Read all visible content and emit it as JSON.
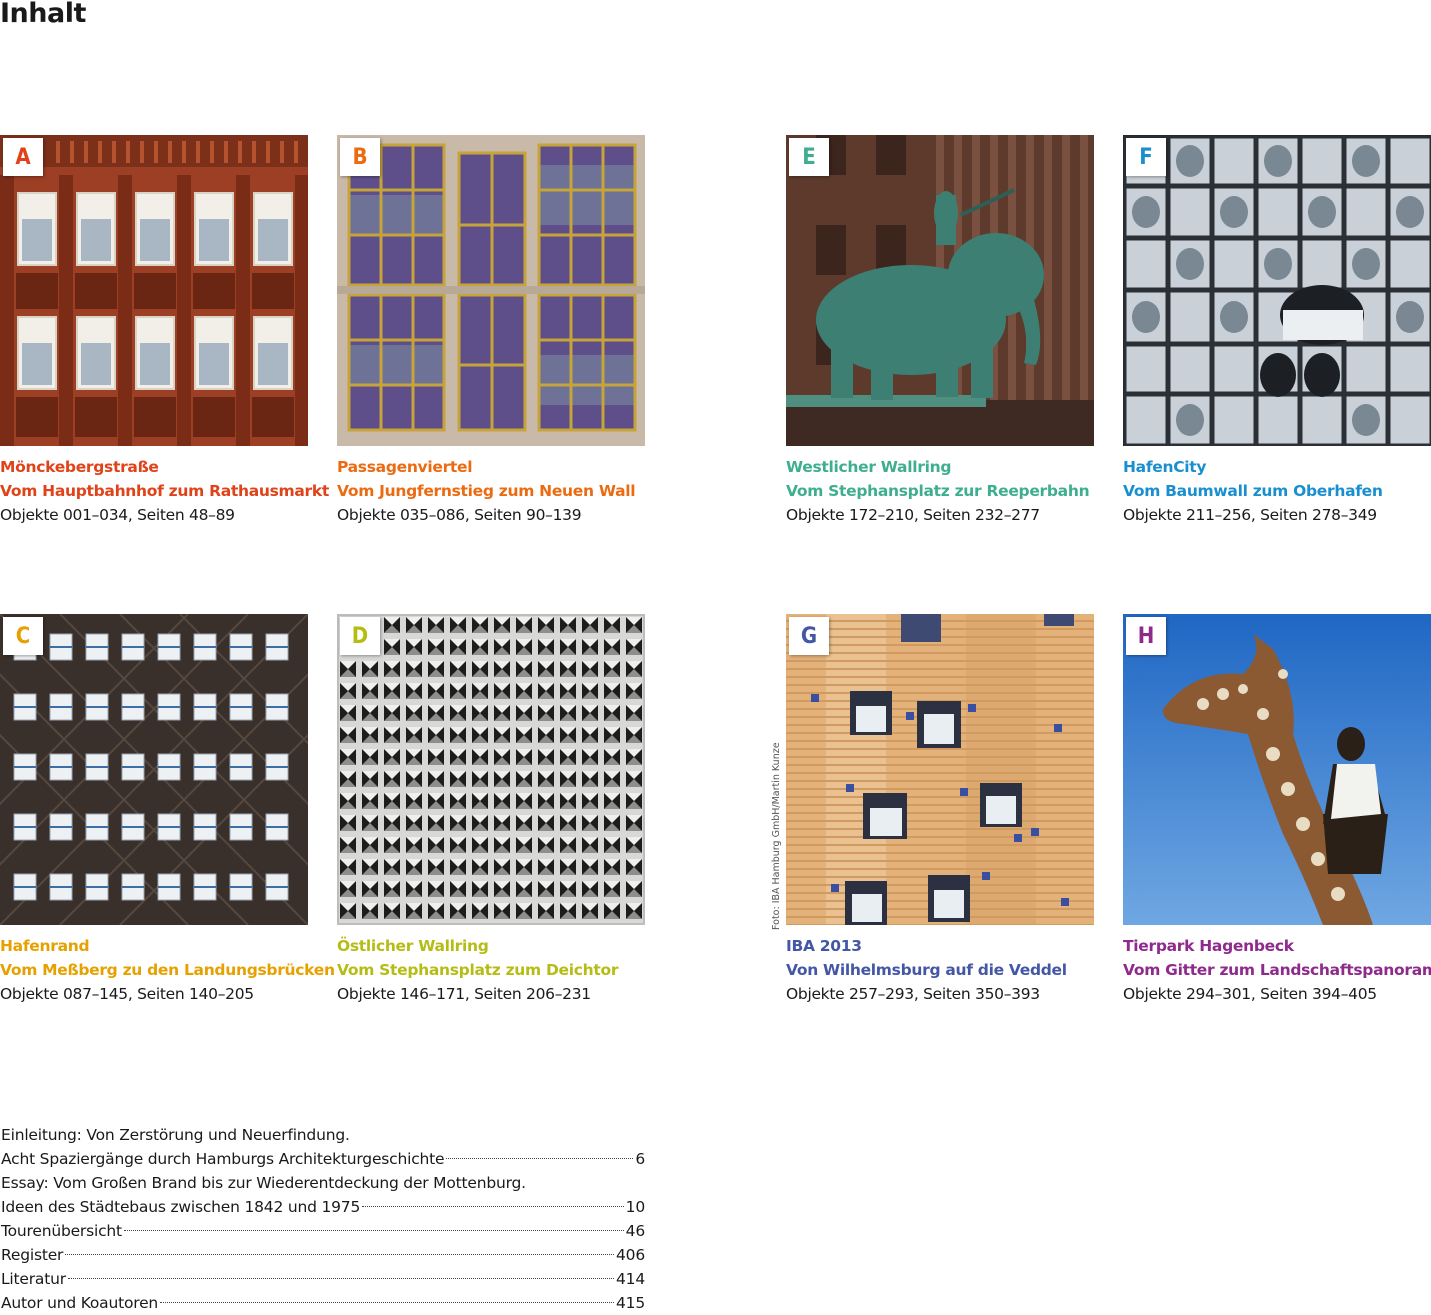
{
  "page": {
    "title": "Inhalt"
  },
  "tours": [
    {
      "letter": "A",
      "color": "#e04319",
      "title": "Mönckebergstraße",
      "subtitle": "Vom Hauptbahnhof zum Rathausmarkt",
      "objects": "Objekte 001–034, Seiten 48–89",
      "photo": "brick-facade-windows"
    },
    {
      "letter": "B",
      "color": "#ec6b10",
      "title": "Passagenviertel",
      "subtitle": "Vom Jungfernstieg zum Neuen Wall",
      "objects": "Objekte 035–086, Seiten 90–139",
      "photo": "glass-facade-gold-frames"
    },
    {
      "letter": "E",
      "color": "#3fae8f",
      "title": "Westlicher Wallring",
      "subtitle": "Vom Stephansplatz zur Reeperbahn",
      "objects": "Objekte 172–210, Seiten 232–277",
      "photo": "bronze-elephant-statue"
    },
    {
      "letter": "F",
      "color": "#1a8fd0",
      "title": "HafenCity",
      "subtitle": "Vom Baumwall zum Oberhafen",
      "objects": "Objekte 211–256, Seiten 278–349",
      "photo": "curved-glass-facade"
    },
    {
      "letter": "C",
      "color": "#e6a100",
      "title": "Hafenrand",
      "subtitle": "Vom Meßberg zu den Landungsbrücken",
      "objects": "Objekte 087–145, Seiten 140–205",
      "photo": "dark-brick-window-grid"
    },
    {
      "letter": "D",
      "color": "#b5bd15",
      "title": "Östlicher Wallring",
      "subtitle": "Vom Stephansplatz zum Deichtor",
      "objects": "Objekte 146–171, Seiten 206–231",
      "photo": "pyramid-concrete-grid"
    },
    {
      "letter": "G",
      "color": "#4457a6",
      "title": "IBA 2013",
      "subtitle": "Von Wilhelmsburg auf die Veddel",
      "objects": "Objekte 257–293, Seiten 350–393",
      "photo": "timber-facade-windows"
    },
    {
      "letter": "H",
      "color": "#8e2a8c",
      "title": "Tierpark Hagenbeck",
      "subtitle": "Vom Gitter zum Landschaftspanorama",
      "objects": "Objekte 294–301, Seiten 394–405",
      "photo": "giraffe-sculpture-sky"
    }
  ],
  "photo_credit": "Foto: IBA Hamburg GmbH/Martin Kunze",
  "toc": [
    {
      "label": "Einleitung: Von Zerstörung und Neuerfindung.",
      "page": ""
    },
    {
      "label": "Acht Spaziergänge durch Hamburgs Architekturgeschichte",
      "page": "6"
    },
    {
      "label": "Essay: Vom Großen Brand bis zur Wiederentdeckung der Mottenburg.",
      "page": ""
    },
    {
      "label": "Ideen des Städtebaus zwischen 1842 und 1975",
      "page": "10"
    },
    {
      "label": "Tourenübersicht",
      "page": "46"
    },
    {
      "label": "Register",
      "page": "406"
    },
    {
      "label": "Literatur",
      "page": "414"
    },
    {
      "label": "Autor und Koautoren",
      "page": "415"
    }
  ]
}
